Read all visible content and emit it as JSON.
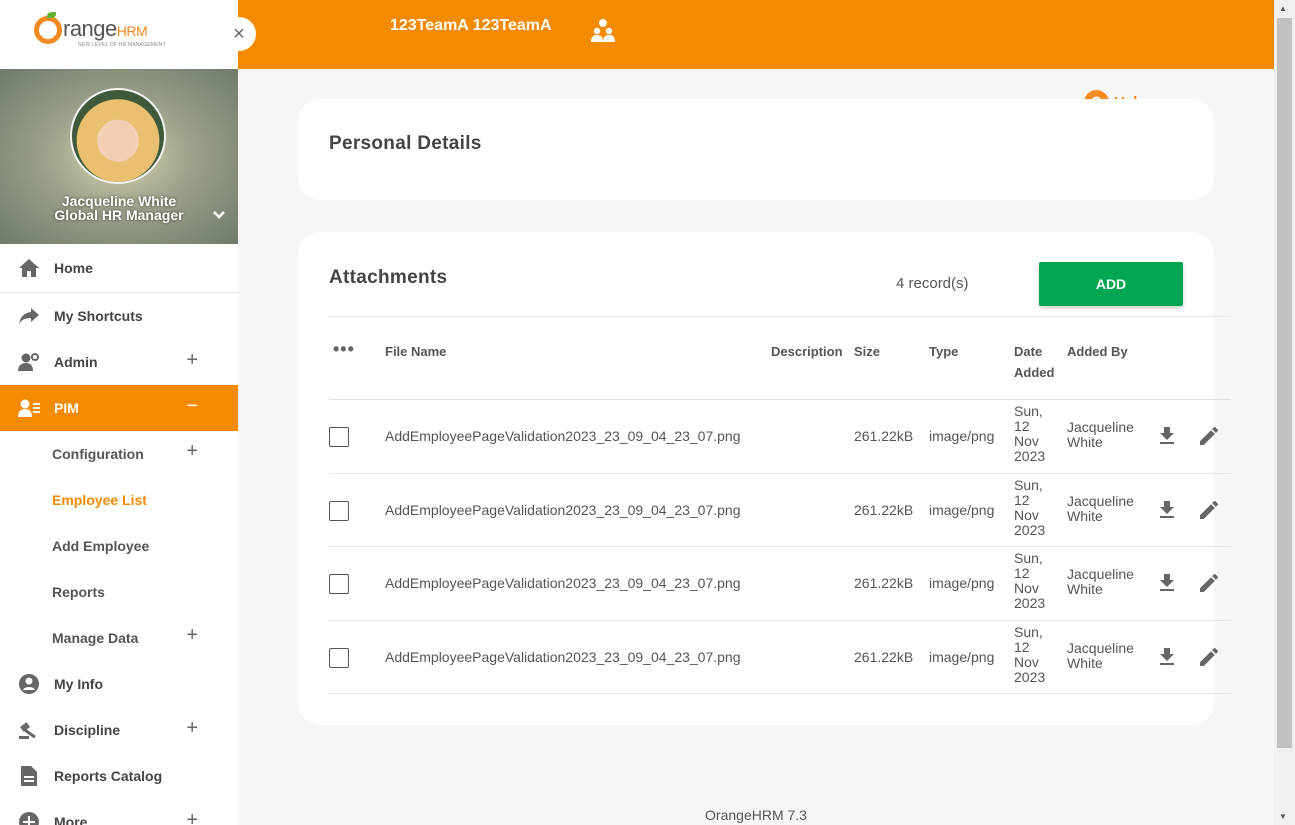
{
  "brand": {
    "logo_main": "range",
    "logo_hrm": "HRM",
    "logo_tagline": "NEW LEVEL OF HR MANAGEMENT"
  },
  "sidebar": {
    "close_label": "×",
    "profile": {
      "name": "Jacqueline White",
      "role": "Global HR Manager",
      "chevron": "⌄"
    },
    "menu": {
      "home": "Home",
      "shortcuts": "My Shortcuts",
      "admin": "Admin",
      "pim": "PIM",
      "pim_sub": {
        "configuration": "Configuration",
        "employee_list": "Employee List",
        "add_employee": "Add Employee",
        "reports": "Reports",
        "manage_data": "Manage Data"
      },
      "my_info": "My Info",
      "discipline": "Discipline",
      "reports_catalog": "Reports Catalog",
      "more": "More"
    },
    "plus": "+",
    "minus": "−"
  },
  "topbar": {
    "team": "123TeamA 123TeamA",
    "accent": "#f38a00"
  },
  "help": {
    "symbol": "?",
    "label": "Help"
  },
  "personal": {
    "title": "Personal Details"
  },
  "attachments": {
    "title": "Attachments",
    "records": "4 record(s)",
    "add_label": "ADD",
    "menu_dots": "•••",
    "columns": {
      "file_name": "File Name",
      "description": "Description",
      "size": "Size",
      "type": "Type",
      "date_added_1": "Date",
      "date_added_2": "Added",
      "added_by": "Added By"
    },
    "rows": [
      {
        "file_name": "AddEmployeePageValidation2023_23_09_04_23_07.png",
        "description": "",
        "size": "261.22kB",
        "type": "image/png",
        "date": [
          "Sun,",
          "12",
          "Nov",
          "2023"
        ],
        "added_by": [
          "Jacqueline",
          "White"
        ]
      },
      {
        "file_name": "AddEmployeePageValidation2023_23_09_04_23_07.png",
        "description": "",
        "size": "261.22kB",
        "type": "image/png",
        "date": [
          "Sun,",
          "12",
          "Nov",
          "2023"
        ],
        "added_by": [
          "Jacqueline",
          "White"
        ]
      },
      {
        "file_name": "AddEmployeePageValidation2023_23_09_04_23_07.png",
        "description": "",
        "size": "261.22kB",
        "type": "image/png",
        "date": [
          "Sun,",
          "12",
          "Nov",
          "2023"
        ],
        "added_by": [
          "Jacqueline",
          "White"
        ]
      },
      {
        "file_name": "AddEmployeePageValidation2023_23_09_04_23_07.png",
        "description": "",
        "size": "261.22kB",
        "type": "image/png",
        "date": [
          "Sun,",
          "12",
          "Nov",
          "2023"
        ],
        "added_by": [
          "Jacqueline",
          "White"
        ]
      }
    ]
  },
  "footer": {
    "version": "OrangeHRM 7.3"
  }
}
